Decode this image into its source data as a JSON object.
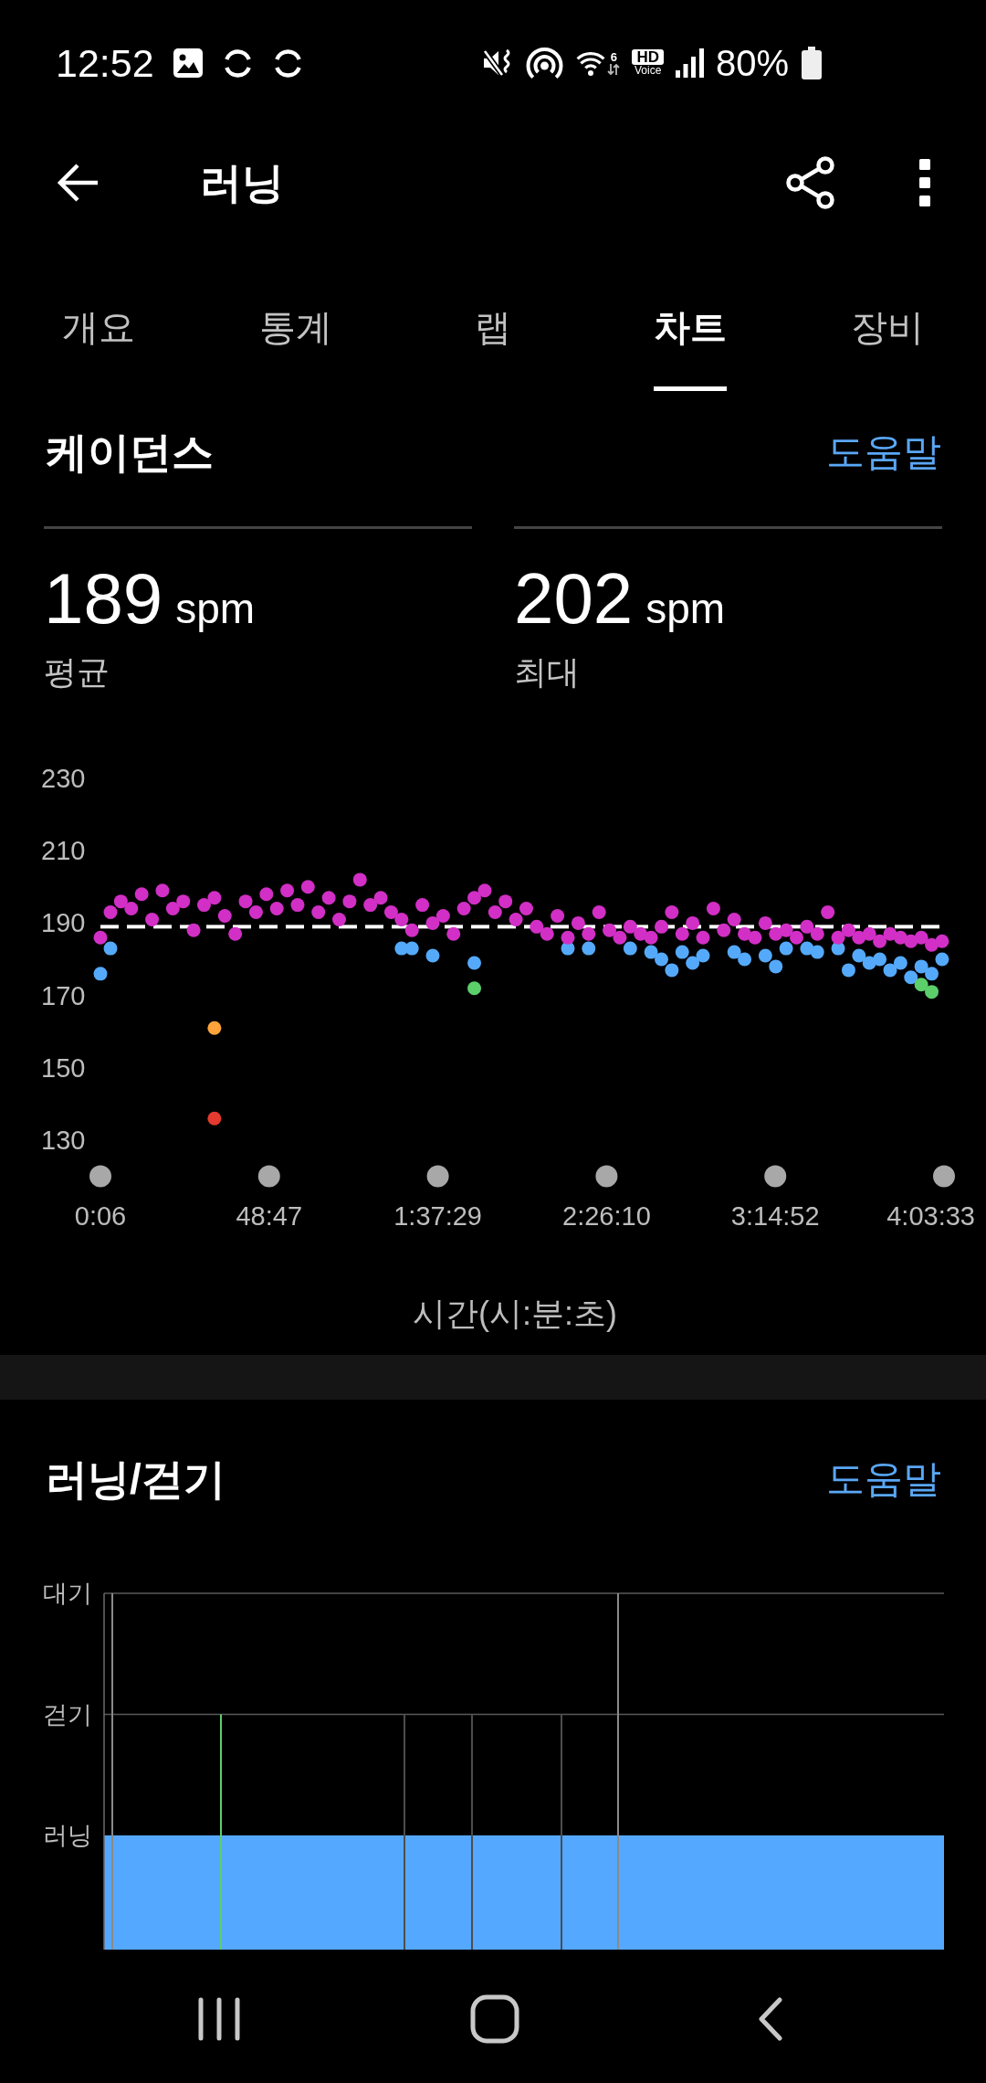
{
  "status_bar": {
    "time": "12:52",
    "wifi_label": "6",
    "hd_voice": {
      "badge": "HD",
      "caption": "Voice"
    },
    "battery": "80%"
  },
  "header": {
    "title": "러닝"
  },
  "tabs": [
    {
      "label": "개요",
      "selected": false
    },
    {
      "label": "통계",
      "selected": false
    },
    {
      "label": "랩",
      "selected": false
    },
    {
      "label": "차트",
      "selected": true
    },
    {
      "label": "장비",
      "selected": false
    }
  ],
  "sections": [
    {
      "kind": "scatter",
      "title": "케이던스",
      "help": "도움말",
      "stats": [
        {
          "value": "189",
          "unit": "spm",
          "label": "평균"
        },
        {
          "value": "202",
          "unit": "spm",
          "label": "최대"
        }
      ],
      "average_line": true,
      "chart_data": {
        "type": "scatter",
        "xlabel": "시간(시:분:초)",
        "x": [
          0.1,
          3,
          6,
          9,
          12,
          15,
          18,
          21,
          24,
          27,
          30,
          33,
          36,
          39,
          42,
          45,
          48,
          51,
          54,
          57,
          60,
          63,
          66,
          69,
          72,
          75,
          78,
          81,
          84,
          87,
          90,
          93,
          96,
          99,
          102,
          105,
          108,
          111,
          114,
          117,
          120,
          123,
          126,
          129,
          132,
          135,
          138,
          141,
          144,
          147,
          150,
          153,
          156,
          159,
          162,
          165,
          168,
          171,
          174,
          177,
          180,
          183,
          186,
          189,
          192,
          195,
          198,
          201,
          204,
          207,
          210,
          213,
          216,
          219,
          222,
          225,
          228,
          231,
          234,
          237,
          240,
          243
        ],
        "series": [
          {
            "color": "#55a9fa",
            "values": [
              176,
              183,
              null,
              null,
              null,
              null,
              null,
              null,
              null,
              null,
              null,
              null,
              null,
              null,
              null,
              null,
              null,
              null,
              null,
              null,
              null,
              null,
              null,
              null,
              null,
              null,
              null,
              null,
              null,
              183,
              183,
              null,
              181,
              null,
              null,
              null,
              179,
              null,
              null,
              null,
              null,
              null,
              null,
              null,
              null,
              183,
              null,
              183,
              null,
              null,
              null,
              183,
              null,
              182,
              180,
              177,
              182,
              179,
              181,
              null,
              null,
              182,
              180,
              null,
              181,
              178,
              183,
              null,
              183,
              182,
              null,
              183,
              177,
              181,
              179,
              180,
              177,
              179,
              175,
              178,
              176,
              180
            ]
          },
          {
            "color": "#5ccf6b",
            "values": [
              null,
              null,
              null,
              null,
              null,
              null,
              null,
              null,
              null,
              null,
              null,
              null,
              null,
              null,
              null,
              null,
              null,
              null,
              null,
              null,
              null,
              null,
              null,
              null,
              null,
              null,
              null,
              null,
              null,
              null,
              null,
              null,
              null,
              null,
              null,
              null,
              172,
              null,
              null,
              null,
              null,
              null,
              null,
              null,
              null,
              null,
              null,
              null,
              null,
              null,
              null,
              null,
              null,
              null,
              null,
              null,
              null,
              null,
              null,
              null,
              null,
              null,
              null,
              null,
              null,
              null,
              null,
              null,
              null,
              null,
              null,
              null,
              null,
              null,
              null,
              null,
              null,
              null,
              null,
              173,
              171,
              null
            ]
          },
          {
            "color": "#d22fc6",
            "values": [
              186,
              193,
              196,
              194,
              198,
              191,
              199,
              194,
              196,
              188,
              195,
              197,
              192,
              187,
              196,
              193,
              198,
              194,
              199,
              195,
              200,
              193,
              197,
              191,
              196,
              202,
              195,
              197,
              193,
              191,
              188,
              195,
              190,
              192,
              187,
              194,
              197,
              199,
              193,
              196,
              191,
              194,
              189,
              187,
              192,
              186,
              190,
              187,
              193,
              188,
              186,
              189,
              187,
              186,
              189,
              193,
              187,
              190,
              186,
              194,
              188,
              191,
              187,
              186,
              190,
              187,
              188,
              186,
              189,
              187,
              193,
              186,
              188,
              186,
              187,
              185,
              187,
              186,
              185,
              186,
              184,
              185
            ]
          },
          {
            "color": "#ffa43b",
            "values": [
              null,
              null,
              null,
              null,
              null,
              null,
              null,
              null,
              null,
              null,
              null,
              161,
              null,
              null,
              null,
              null,
              null,
              null,
              null,
              null,
              null,
              null,
              null,
              null,
              null,
              null,
              null,
              null,
              null,
              null,
              null,
              null,
              null,
              null,
              null,
              null,
              null,
              null,
              null,
              null,
              null,
              null,
              null,
              null,
              null,
              null,
              null,
              null,
              null,
              null,
              null,
              null,
              null,
              null,
              null,
              null,
              null,
              null,
              null,
              null,
              null,
              null,
              null,
              null,
              null,
              null,
              null,
              null,
              null,
              null,
              null,
              null,
              null,
              null,
              null,
              null,
              null,
              null,
              null,
              null,
              null,
              null
            ]
          },
          {
            "color": "#e53a2f",
            "values": [
              null,
              null,
              null,
              null,
              null,
              null,
              null,
              null,
              null,
              null,
              null,
              136,
              null,
              null,
              null,
              null,
              null,
              null,
              null,
              null,
              null,
              null,
              null,
              null,
              null,
              null,
              null,
              null,
              null,
              null,
              null,
              null,
              null,
              null,
              null,
              null,
              null,
              null,
              null,
              null,
              null,
              null,
              null,
              null,
              null,
              null,
              null,
              null,
              null,
              null,
              null,
              null,
              null,
              null,
              null,
              null,
              null,
              null,
              null,
              null,
              null,
              null,
              null,
              null,
              null,
              null,
              null,
              null,
              null,
              null,
              null,
              null,
              null,
              null,
              null,
              null,
              null,
              null,
              null,
              null,
              null,
              null
            ]
          }
        ],
        "xlim": [
          0.1,
          243.55
        ],
        "ylim": [
          130,
          230
        ],
        "xticks": [
          {
            "value": 0.1,
            "label": "0:06"
          },
          {
            "value": 48.78,
            "label": "48:47"
          },
          {
            "value": 97.48,
            "label": "1:37:29"
          },
          {
            "value": 146.17,
            "label": "2:26:10"
          },
          {
            "value": 194.87,
            "label": "3:14:52"
          },
          {
            "value": 243.55,
            "label": "4:03:33"
          }
        ],
        "yticks": [
          130,
          150,
          170,
          190,
          210,
          230
        ]
      }
    },
    {
      "kind": "state",
      "title": "러닝/걷기",
      "help": "도움말",
      "state_chart": {
        "y_labels": [
          "대기",
          "걷기",
          "러닝"
        ]
      }
    }
  ]
}
